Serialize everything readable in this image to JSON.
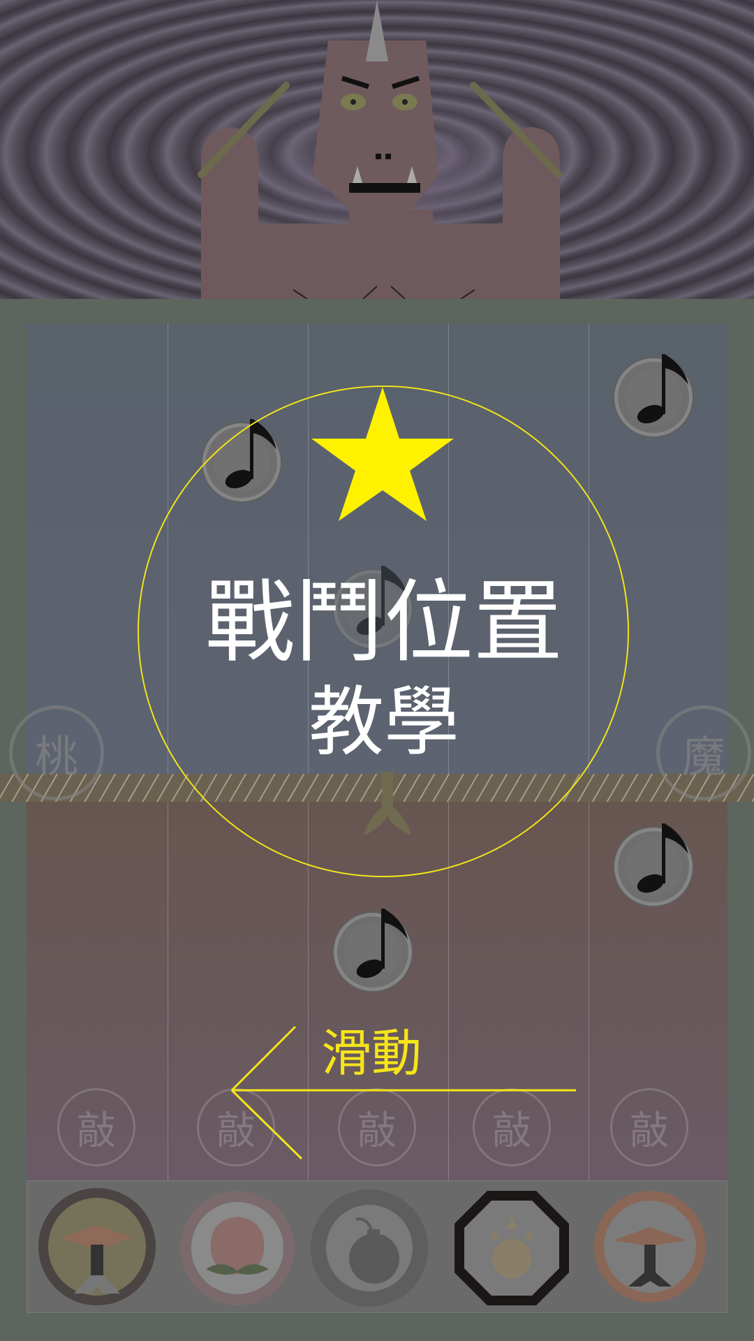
{
  "tutorial": {
    "title_line1": "戰鬥位置",
    "title_line2": "教學",
    "swipe_label": "滑動",
    "accent_color": "#f5e51a"
  },
  "side_labels": {
    "player": "桃",
    "enemy": "魔"
  },
  "tap_zones": [
    "敲",
    "敲",
    "敲",
    "敲",
    "敲"
  ],
  "icons": {
    "boss": "oni-drummer",
    "star": "star-icon",
    "notes": "music-note-icon",
    "items": [
      "drum-stand-icon",
      "peach-icon",
      "bomb-icon",
      "octagon-shield-icon",
      "drum-stand-icon"
    ]
  },
  "selected_item_index": 3
}
